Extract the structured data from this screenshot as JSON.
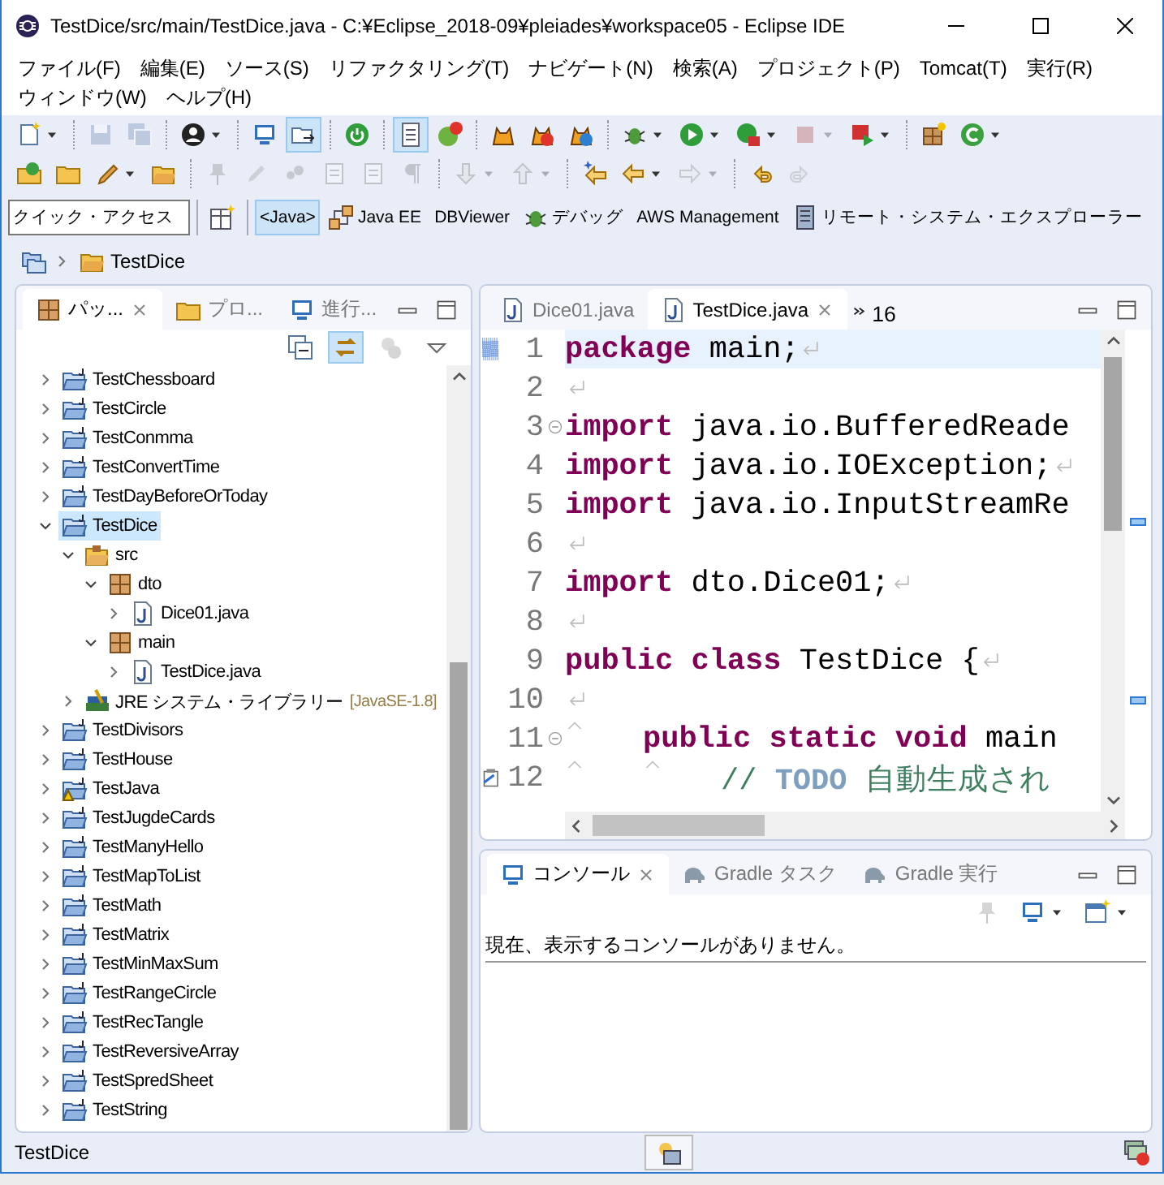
{
  "window": {
    "title": "TestDice/src/main/TestDice.java - C:¥Eclipse_2018-09¥pleiades¥workspace05 - Eclipse IDE"
  },
  "menu": [
    {
      "label": "ファイル(F)"
    },
    {
      "label": "編集(E)"
    },
    {
      "label": "ソース(S)"
    },
    {
      "label": "リファクタリング(T)"
    },
    {
      "label": "ナビゲート(N)"
    },
    {
      "label": "検索(A)"
    },
    {
      "label": "プロジェクト(P)"
    },
    {
      "label": "Tomcat(T)"
    },
    {
      "label": "実行(R)"
    },
    {
      "label": "ウィンドウ(W)"
    },
    {
      "label": "ヘルプ(H)"
    }
  ],
  "toolbar_rows": [
    [
      {
        "kind": "button",
        "pressed": false,
        "disabled": false,
        "dropdown": true
      },
      {
        "kind": "separator"
      },
      {
        "kind": "button",
        "pressed": false,
        "disabled": true,
        "dropdown": false
      },
      {
        "kind": "button",
        "pressed": false,
        "disabled": true,
        "dropdown": false
      },
      {
        "kind": "separator"
      },
      {
        "kind": "button",
        "pressed": false,
        "disabled": false,
        "dropdown": true
      },
      {
        "kind": "separator"
      },
      {
        "kind": "button",
        "pressed": false,
        "disabled": false,
        "dropdown": false
      },
      {
        "kind": "button",
        "pressed": true,
        "disabled": false,
        "dropdown": false
      },
      {
        "kind": "separator"
      },
      {
        "kind": "button",
        "pressed": false,
        "disabled": false,
        "dropdown": false
      },
      {
        "kind": "separator"
      },
      {
        "kind": "button",
        "pressed": true,
        "disabled": false,
        "dropdown": false
      },
      {
        "kind": "button",
        "pressed": false,
        "disabled": false,
        "dropdown": false
      },
      {
        "kind": "separator"
      },
      {
        "kind": "button",
        "pressed": false,
        "disabled": false,
        "dropdown": false
      },
      {
        "kind": "button",
        "pressed": false,
        "disabled": false,
        "dropdown": false
      },
      {
        "kind": "button",
        "pressed": false,
        "disabled": false,
        "dropdown": false
      },
      {
        "kind": "separator"
      },
      {
        "kind": "button",
        "pressed": false,
        "disabled": false,
        "dropdown": true
      },
      {
        "kind": "button",
        "pressed": false,
        "disabled": false,
        "dropdown": true
      },
      {
        "kind": "button",
        "pressed": false,
        "disabled": false,
        "dropdown": true
      },
      {
        "kind": "button",
        "pressed": false,
        "disabled": true,
        "dropdown": true
      },
      {
        "kind": "button",
        "pressed": false,
        "disabled": false,
        "dropdown": true
      },
      {
        "kind": "separator"
      },
      {
        "kind": "button",
        "pressed": false,
        "disabled": false,
        "dropdown": false
      },
      {
        "kind": "button",
        "pressed": false,
        "disabled": false,
        "dropdown": true
      }
    ],
    [
      {
        "kind": "button",
        "pressed": false,
        "disabled": false,
        "dropdown": false
      },
      {
        "kind": "button",
        "pressed": false,
        "disabled": false,
        "dropdown": false
      },
      {
        "kind": "button",
        "pressed": false,
        "disabled": false,
        "dropdown": true
      },
      {
        "kind": "button",
        "pressed": false,
        "disabled": false,
        "dropdown": false
      },
      {
        "kind": "separator"
      },
      {
        "kind": "button",
        "pressed": false,
        "disabled": true,
        "dropdown": false
      },
      {
        "kind": "button",
        "pressed": false,
        "disabled": true,
        "dropdown": false
      },
      {
        "kind": "button",
        "pressed": false,
        "disabled": true,
        "dropdown": false
      },
      {
        "kind": "button",
        "pressed": false,
        "disabled": true,
        "dropdown": false
      },
      {
        "kind": "button",
        "pressed": false,
        "disabled": true,
        "dropdown": false
      },
      {
        "kind": "button",
        "pressed": false,
        "disabled": true,
        "dropdown": false
      },
      {
        "kind": "separator"
      },
      {
        "kind": "button",
        "pressed": false,
        "disabled": true,
        "dropdown": true
      },
      {
        "kind": "button",
        "pressed": false,
        "disabled": true,
        "dropdown": true
      },
      {
        "kind": "separator"
      },
      {
        "kind": "button",
        "pressed": false,
        "disabled": false,
        "dropdown": false
      },
      {
        "kind": "button",
        "pressed": false,
        "disabled": false,
        "dropdown": true
      },
      {
        "kind": "button",
        "pressed": false,
        "disabled": true,
        "dropdown": true
      },
      {
        "kind": "separator"
      },
      {
        "kind": "button",
        "pressed": false,
        "disabled": false,
        "dropdown": false
      },
      {
        "kind": "button",
        "pressed": false,
        "disabled": true,
        "dropdown": false
      }
    ]
  ],
  "quick_access": {
    "placeholder": "クイック・アクセス"
  },
  "perspectives": [
    {
      "label": "<Java>",
      "selected": true
    },
    {
      "label": "Java EE",
      "selected": false
    },
    {
      "label": "DBViewer",
      "selected": false
    },
    {
      "label": "デバッグ",
      "selected": false
    },
    {
      "label": "AWS Management",
      "selected": false
    },
    {
      "label": "リモート・システム・エクスプローラー",
      "selected": false
    }
  ],
  "breadcrumb": [
    {
      "label": "TestDice"
    }
  ],
  "explorer": {
    "tabs": [
      {
        "label": "パッ...",
        "selected": true
      },
      {
        "label": "プロ...",
        "selected": false
      },
      {
        "label": "進行...",
        "selected": false
      }
    ],
    "toolbar": [
      {
        "pressed": false,
        "disabled": false
      },
      {
        "pressed": true,
        "disabled": false
      },
      {
        "pressed": false,
        "disabled": true
      },
      {
        "pressed": false,
        "disabled": false
      }
    ],
    "tree": [
      {
        "label": "TestChessboard",
        "kind": "project",
        "expanded": false,
        "selected": false,
        "warning": false
      },
      {
        "label": "TestCircle",
        "kind": "project",
        "expanded": false,
        "selected": false,
        "warning": false
      },
      {
        "label": "TestConmma",
        "kind": "project",
        "expanded": false,
        "selected": false,
        "warning": false
      },
      {
        "label": "TestConvertTime",
        "kind": "project",
        "expanded": false,
        "selected": false,
        "warning": false
      },
      {
        "label": "TestDayBeforeOrToday",
        "kind": "project",
        "expanded": false,
        "selected": false,
        "warning": false
      },
      {
        "label": "TestDice",
        "kind": "project",
        "expanded": true,
        "selected": true,
        "warning": false,
        "children": [
          {
            "label": "src",
            "kind": "source",
            "expanded": true,
            "selected": false,
            "warning": false,
            "children": [
              {
                "label": "dto",
                "kind": "package",
                "expanded": true,
                "selected": false,
                "warning": false,
                "children": [
                  {
                    "label": "Dice01.java",
                    "kind": "file",
                    "expanded": false,
                    "selected": false,
                    "warning": false
                  }
                ]
              },
              {
                "label": "main",
                "kind": "package",
                "expanded": true,
                "selected": false,
                "warning": false,
                "children": [
                  {
                    "label": "TestDice.java",
                    "kind": "file",
                    "expanded": false,
                    "selected": false,
                    "warning": false
                  }
                ]
              }
            ]
          },
          {
            "label": "JRE システム・ライブラリー",
            "decoration": "[JavaSE-1.8]",
            "kind": "library",
            "expanded": false,
            "selected": false,
            "warning": false
          }
        ]
      },
      {
        "label": "TestDivisors",
        "kind": "project",
        "expanded": false,
        "selected": false,
        "warning": false
      },
      {
        "label": "TestHouse",
        "kind": "project",
        "expanded": false,
        "selected": false,
        "warning": false
      },
      {
        "label": "TestJava",
        "kind": "project",
        "expanded": false,
        "selected": false,
        "warning": true
      },
      {
        "label": "TestJugdeCards",
        "kind": "project",
        "expanded": false,
        "selected": false,
        "warning": false
      },
      {
        "label": "TestManyHello",
        "kind": "project",
        "expanded": false,
        "selected": false,
        "warning": false
      },
      {
        "label": "TestMapToList",
        "kind": "project",
        "expanded": false,
        "selected": false,
        "warning": false
      },
      {
        "label": "TestMath",
        "kind": "project",
        "expanded": false,
        "selected": false,
        "warning": false
      },
      {
        "label": "TestMatrix",
        "kind": "project",
        "expanded": false,
        "selected": false,
        "warning": false
      },
      {
        "label": "TestMinMaxSum",
        "kind": "project",
        "expanded": false,
        "selected": false,
        "warning": false
      },
      {
        "label": "TestRangeCircle",
        "kind": "project",
        "expanded": false,
        "selected": false,
        "warning": false
      },
      {
        "label": "TestRecTangle",
        "kind": "project",
        "expanded": false,
        "selected": false,
        "warning": false
      },
      {
        "label": "TestReversiveArray",
        "kind": "project",
        "expanded": false,
        "selected": false,
        "warning": false
      },
      {
        "label": "TestSpredSheet",
        "kind": "project",
        "expanded": false,
        "selected": false,
        "warning": false
      },
      {
        "label": "TestString",
        "kind": "project",
        "expanded": false,
        "selected": false,
        "warning": false
      }
    ]
  },
  "editor": {
    "tabs": [
      {
        "label": "Dice01.java",
        "selected": false
      },
      {
        "label": "TestDice.java",
        "selected": true
      }
    ],
    "overflow_count": "16",
    "lines": [
      {
        "number": "1",
        "current": true,
        "fold": false,
        "eol": true,
        "changed": true,
        "task": false,
        "tokens": [
          {
            "kind": "keyword",
            "text": "package"
          },
          {
            "kind": "plain",
            "text": " main;"
          }
        ]
      },
      {
        "number": "2",
        "current": false,
        "fold": false,
        "eol": true,
        "changed": false,
        "task": false
      },
      {
        "number": "3",
        "current": false,
        "fold": true,
        "eol": false,
        "changed": false,
        "task": false,
        "tokens": [
          {
            "kind": "keyword",
            "text": "import"
          },
          {
            "kind": "plain",
            "text": " java.io.BufferedReade"
          }
        ]
      },
      {
        "number": "4",
        "current": false,
        "fold": false,
        "eol": true,
        "changed": false,
        "task": false,
        "tokens": [
          {
            "kind": "keyword",
            "text": "import"
          },
          {
            "kind": "plain",
            "text": " java.io.IOException;"
          }
        ]
      },
      {
        "number": "5",
        "current": false,
        "fold": false,
        "eol": false,
        "changed": false,
        "task": false,
        "tokens": [
          {
            "kind": "keyword",
            "text": "import"
          },
          {
            "kind": "plain",
            "text": " java.io.InputStreamRe"
          }
        ]
      },
      {
        "number": "6",
        "current": false,
        "fold": false,
        "eol": true,
        "changed": false,
        "task": false
      },
      {
        "number": "7",
        "current": false,
        "fold": false,
        "eol": true,
        "changed": false,
        "task": false,
        "tokens": [
          {
            "kind": "keyword",
            "text": "import"
          },
          {
            "kind": "plain",
            "text": " dto.Dice01;"
          }
        ]
      },
      {
        "number": "8",
        "current": false,
        "fold": false,
        "eol": true,
        "changed": false,
        "task": false
      },
      {
        "number": "9",
        "current": false,
        "fold": false,
        "eol": true,
        "changed": false,
        "task": false,
        "tokens": [
          {
            "kind": "keyword",
            "text": "public class"
          },
          {
            "kind": "plain",
            "text": " TestDice {"
          }
        ]
      },
      {
        "number": "10",
        "current": false,
        "fold": false,
        "eol": true,
        "changed": false,
        "task": false
      },
      {
        "number": "11",
        "current": false,
        "fold": true,
        "eol": false,
        "changed": false,
        "task": false,
        "tokens": [
          {
            "kind": "tab"
          },
          {
            "kind": "keyword",
            "text": "public static void"
          },
          {
            "kind": "plain",
            "text": " main"
          }
        ]
      },
      {
        "number": "12",
        "current": false,
        "fold": false,
        "eol": false,
        "changed": false,
        "task": true,
        "tokens": [
          {
            "kind": "tab"
          },
          {
            "kind": "tab"
          },
          {
            "kind": "comment",
            "text": "// "
          },
          {
            "kind": "todo",
            "text": "TODO"
          },
          {
            "kind": "comment",
            "text": " 自動生成され"
          }
        ]
      }
    ]
  },
  "console": {
    "tabs": [
      {
        "label": "コンソール",
        "selected": true
      },
      {
        "label": "Gradle タスク",
        "selected": false
      },
      {
        "label": "Gradle 実行",
        "selected": false
      }
    ],
    "toolbar": [
      {
        "disabled": true,
        "dropdown": false
      },
      {
        "disabled": false,
        "dropdown": true
      },
      {
        "disabled": false,
        "dropdown": true
      }
    ],
    "message": "現在、表示するコンソールがありません。"
  },
  "status_bar": {
    "text": "TestDice"
  }
}
